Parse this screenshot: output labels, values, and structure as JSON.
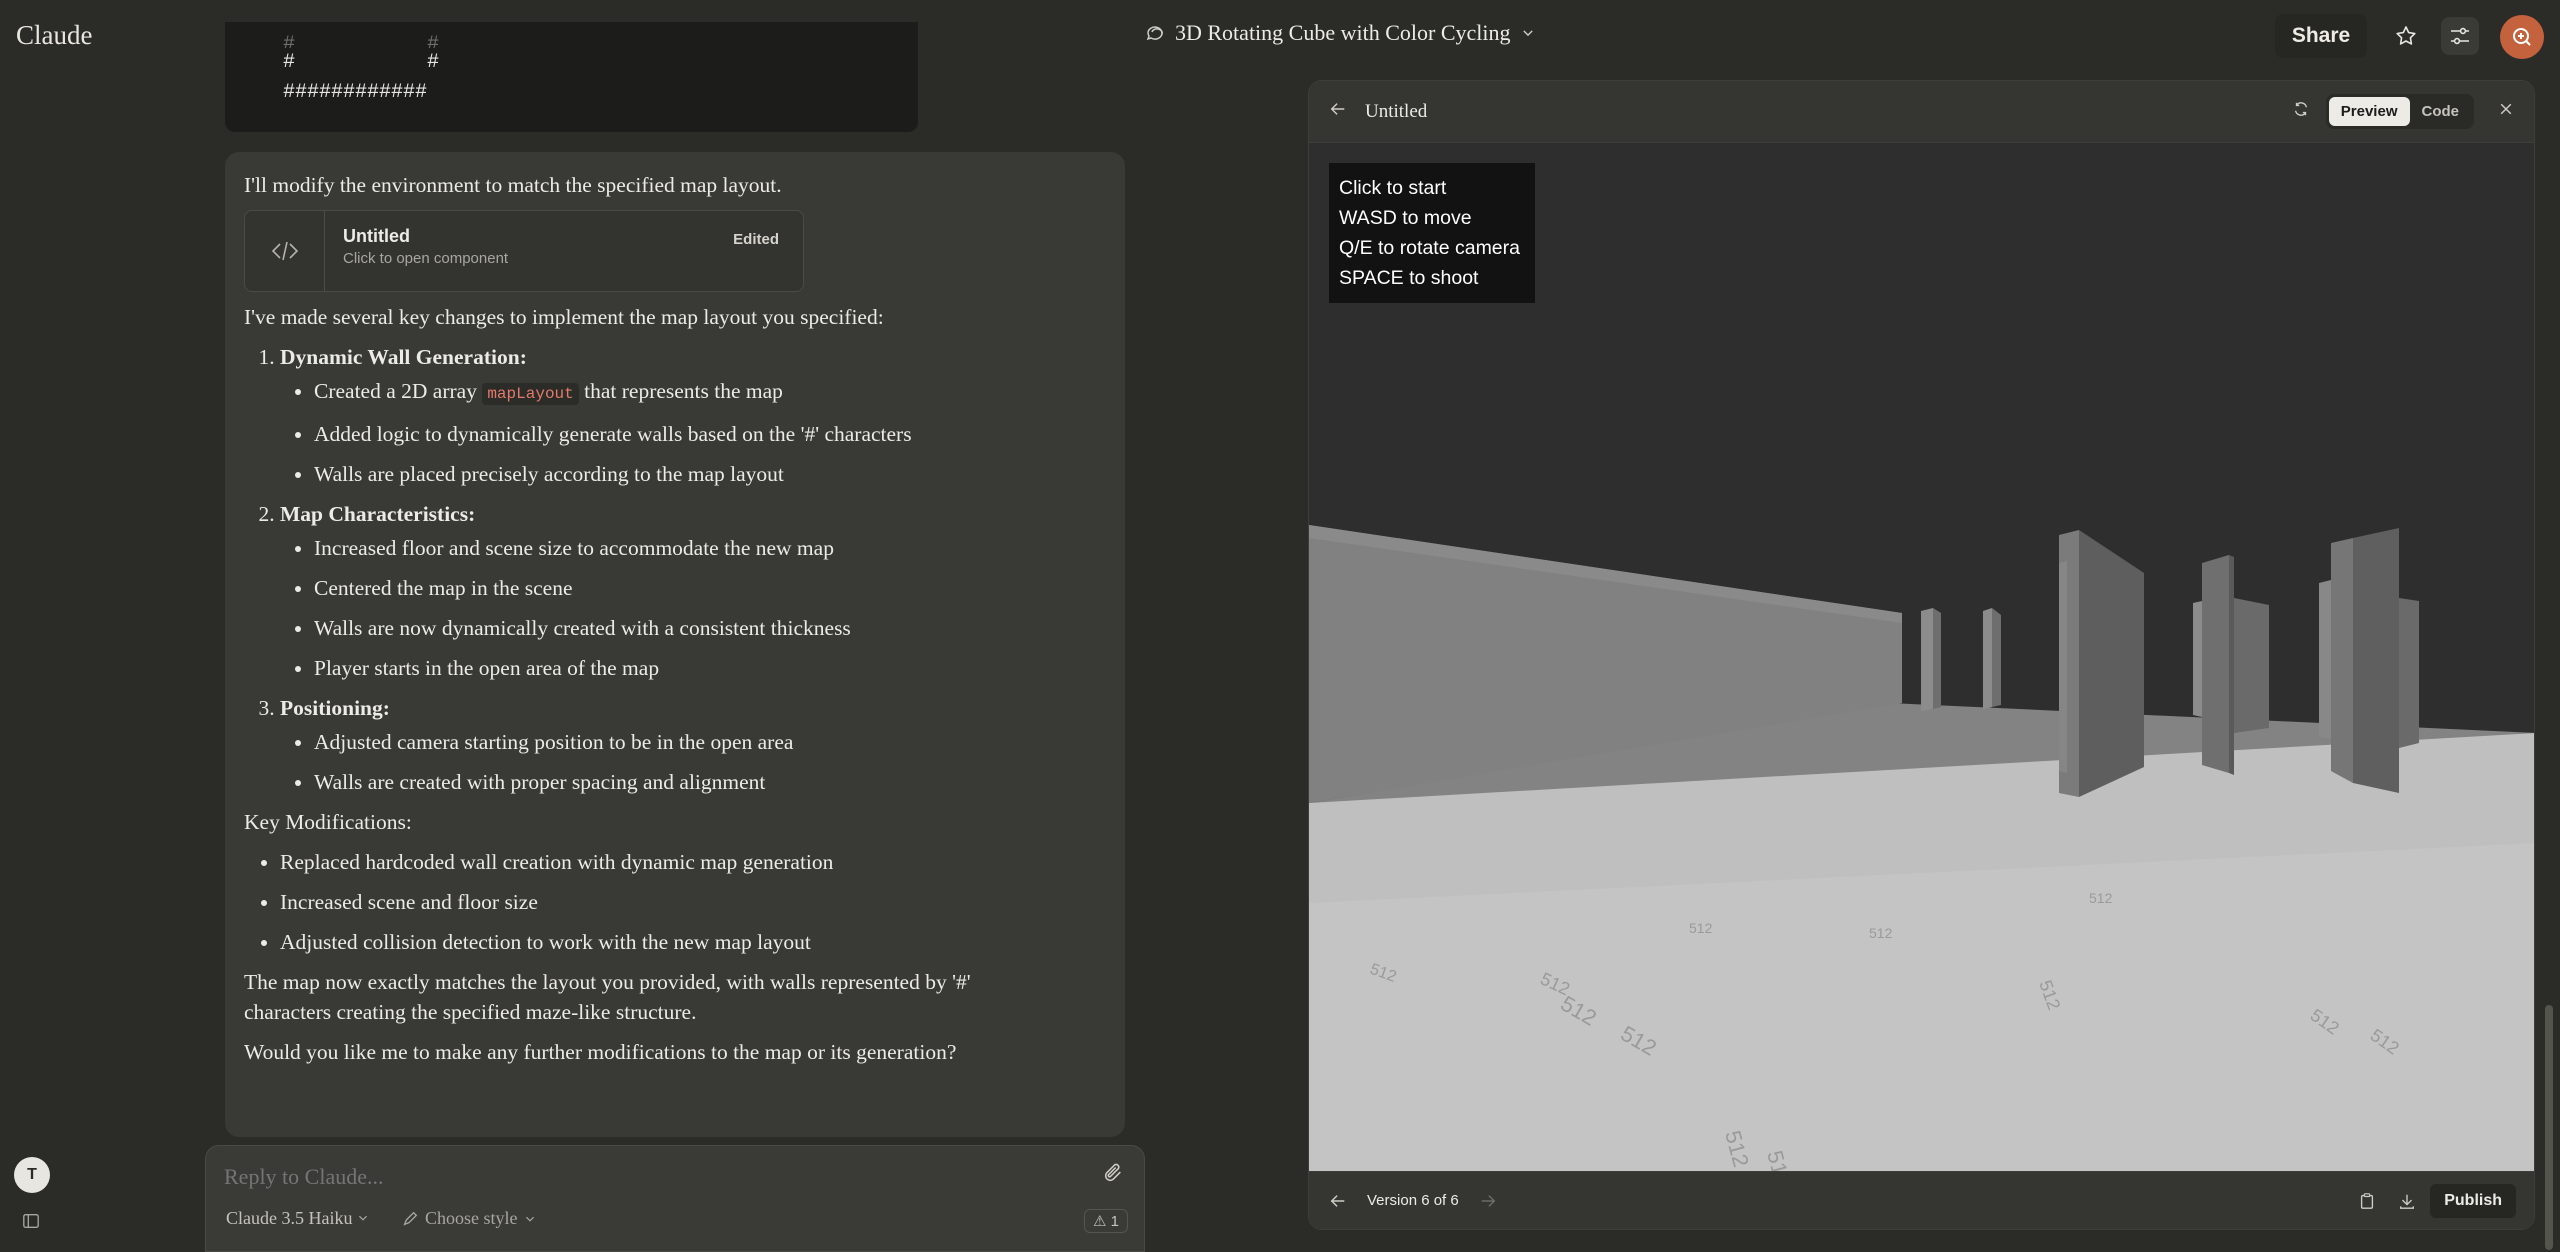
{
  "app": {
    "logo": "Claude"
  },
  "header": {
    "chat_title": "3D Rotating Cube with Color Cycling",
    "share_label": "Share"
  },
  "code_block": {
    "line1": "#           #",
    "line2": "#           #",
    "line3": "############"
  },
  "message": {
    "intro": "I'll modify the environment to match the specified map layout.",
    "artifact": {
      "title": "Untitled",
      "subtitle": "Click to open component",
      "badge": "Edited"
    },
    "lead": "I've made several key changes to implement the map layout you specified:",
    "sections": [
      {
        "title": "Dynamic Wall Generation",
        "items": [
          "Created a 2D array",
          "Added logic to dynamically generate walls based on the '#' characters",
          "Walls are placed precisely according to the map layout"
        ],
        "code": "mapLayout",
        "code_suffix": "that represents the map"
      },
      {
        "title": "Map Characteristics",
        "items": [
          "Increased floor and scene size to accommodate the new map",
          "Centered the map in the scene",
          "Walls are now dynamically created with a consistent thickness",
          "Player starts in the open area of the map"
        ]
      },
      {
        "title": "Positioning",
        "items": [
          "Adjusted camera starting position to be in the open area",
          "Walls are created with proper spacing and alignment"
        ]
      }
    ],
    "key_mods_label": "Key Modifications:",
    "key_mods": [
      "Replaced hardcoded wall creation with dynamic map generation",
      "Increased scene and floor size",
      "Adjusted collision detection to work with the new map layout"
    ],
    "closing1": "The map now exactly matches the layout you provided, with walls represented by '#' characters creating the specified maze-like structure.",
    "closing2": "Would you like me to make any further modifications to the map or its generation?"
  },
  "reply": {
    "placeholder": "Reply to Claude...",
    "model": "Claude 3.5 Haiku",
    "style": "Choose style",
    "count": "1"
  },
  "user": {
    "initial": "T"
  },
  "panel": {
    "title": "Untitled",
    "preview_label": "Preview",
    "code_label": "Code",
    "instructions": [
      "Click to start",
      "WASD to move",
      "Q/E to rotate camera",
      "SPACE to shoot"
    ],
    "version": "Version 6 of 6",
    "publish_label": "Publish",
    "floor_label": "512"
  },
  "colors": {
    "background": "#2b2b28",
    "accent": "#c4623e"
  }
}
